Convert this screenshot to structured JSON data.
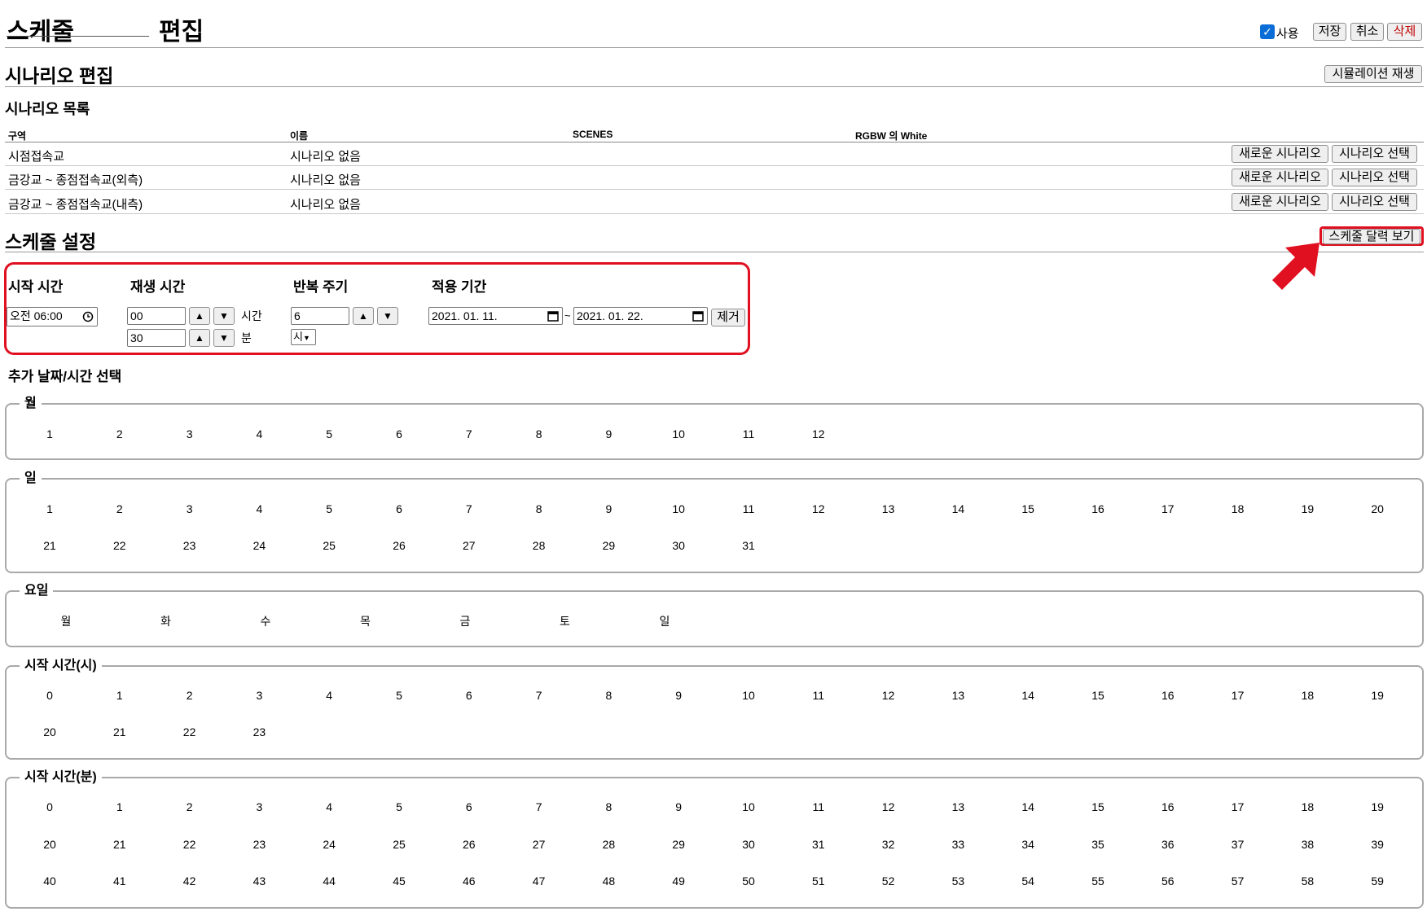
{
  "header": {
    "title": "스케줄",
    "subtitle": "편집",
    "use_label": "사용",
    "use_checked": true,
    "save": "저장",
    "cancel": "취소",
    "delete": "삭제"
  },
  "scenario_edit": {
    "title": "시나리오 편집",
    "simulate": "시뮬레이션 재생"
  },
  "scenario_list": {
    "title": "시나리오 목록",
    "columns": [
      "구역",
      "이름",
      "SCENES",
      "RGBW 의 White"
    ],
    "rows": [
      {
        "zone": "시점접속교",
        "name": "시나리오 없음",
        "new_btn": "새로운 시나리오",
        "select_btn": "시나리오 선택"
      },
      {
        "zone": "금강교 ~ 종점접속교(외측)",
        "name": "시나리오 없음",
        "new_btn": "새로운 시나리오",
        "select_btn": "시나리오 선택"
      },
      {
        "zone": "금강교 ~ 종점접속교(내측)",
        "name": "시나리오 없음",
        "new_btn": "새로운 시나리오",
        "select_btn": "시나리오 선택"
      }
    ]
  },
  "schedule": {
    "title": "스케줄 설정",
    "calendar_btn": "스케줄 달력 보기",
    "start_time": {
      "label": "시작 시간",
      "value": "오전 06:00"
    },
    "play_time": {
      "label": "재생 시간",
      "hours": "00",
      "hours_unit": "시간",
      "minutes": "30",
      "minutes_unit": "분"
    },
    "repeat": {
      "label": "반복 주기",
      "value": "6",
      "unit": "시"
    },
    "period": {
      "label": "적용 기간",
      "start": "2021. 01. 11.",
      "tilde": "~",
      "end": "2021. 01. 22.",
      "remove": "제거"
    },
    "up_arrow": "▲",
    "down_arrow": "▼"
  },
  "extra": {
    "title": "추가 날짜/시간 선택",
    "month": {
      "legend": "월",
      "values": [
        "1",
        "2",
        "3",
        "4",
        "5",
        "6",
        "7",
        "8",
        "9",
        "10",
        "11",
        "12"
      ]
    },
    "day": {
      "legend": "일",
      "values": [
        "1",
        "2",
        "3",
        "4",
        "5",
        "6",
        "7",
        "8",
        "9",
        "10",
        "11",
        "12",
        "13",
        "14",
        "15",
        "16",
        "17",
        "18",
        "19",
        "20",
        "21",
        "22",
        "23",
        "24",
        "25",
        "26",
        "27",
        "28",
        "29",
        "30",
        "31"
      ]
    },
    "weekday": {
      "legend": "요일",
      "values": [
        "월",
        "화",
        "수",
        "목",
        "금",
        "토",
        "일"
      ]
    },
    "hour": {
      "legend": "시작 시간(시)",
      "values": [
        "0",
        "1",
        "2",
        "3",
        "4",
        "5",
        "6",
        "7",
        "8",
        "9",
        "10",
        "11",
        "12",
        "13",
        "14",
        "15",
        "16",
        "17",
        "18",
        "19",
        "20",
        "21",
        "22",
        "23"
      ]
    },
    "minute": {
      "legend": "시작 시간(분)",
      "values": [
        "0",
        "1",
        "2",
        "3",
        "4",
        "5",
        "6",
        "7",
        "8",
        "9",
        "10",
        "11",
        "12",
        "13",
        "14",
        "15",
        "16",
        "17",
        "18",
        "19",
        "20",
        "21",
        "22",
        "23",
        "24",
        "25",
        "26",
        "27",
        "28",
        "29",
        "30",
        "31",
        "32",
        "33",
        "34",
        "35",
        "36",
        "37",
        "38",
        "39",
        "40",
        "41",
        "42",
        "43",
        "44",
        "45",
        "46",
        "47",
        "48",
        "49",
        "50",
        "51",
        "52",
        "53",
        "54",
        "55",
        "56",
        "57",
        "58",
        "59"
      ]
    }
  },
  "colors": {
    "highlight": "#e01020",
    "delete_text": "#c00000",
    "checkbox": "#0a6cd6"
  }
}
